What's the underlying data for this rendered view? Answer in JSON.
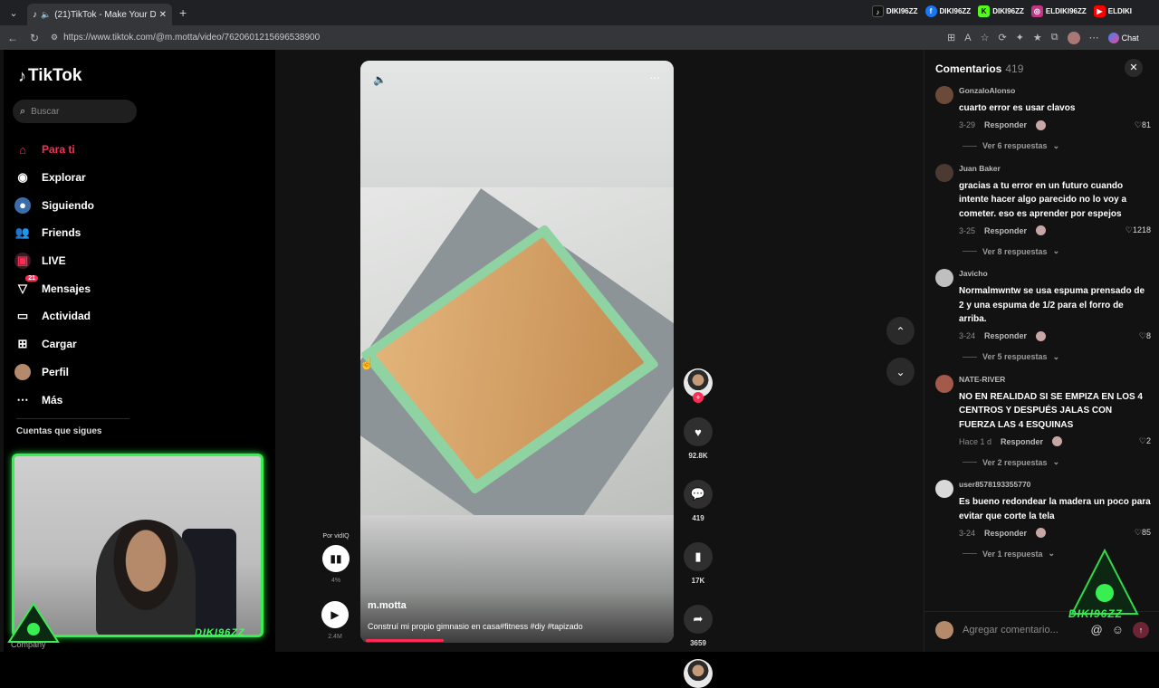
{
  "browser": {
    "tab_count": "(21)",
    "tab_title": "TikTok - Make Your Day",
    "url": "https://www.tiktok.com/@m.motta/video/7620601215696538900",
    "extensions": [
      "DIKI96ZZ",
      "DIKI96ZZ",
      "DIKI96ZZ",
      "ELDIKI96ZZ",
      "ELDIKI"
    ],
    "chat_label": "Chat"
  },
  "sidebar": {
    "logo": "TikTok",
    "search_placeholder": "Buscar",
    "items": [
      {
        "label": "Para ti",
        "icon": "home-icon"
      },
      {
        "label": "Explorar",
        "icon": "compass-icon"
      },
      {
        "label": "Siguiendo",
        "icon": "following-icon"
      },
      {
        "label": "Friends",
        "icon": "friends-icon"
      },
      {
        "label": "LIVE",
        "icon": "live-icon"
      },
      {
        "label": "Mensajes",
        "icon": "message-icon",
        "badge": "21"
      },
      {
        "label": "Actividad",
        "icon": "activity-icon"
      },
      {
        "label": "Cargar",
        "icon": "upload-icon"
      },
      {
        "label": "Perfil",
        "icon": "profile-icon"
      },
      {
        "label": "Más",
        "icon": "more-icon"
      }
    ],
    "following_header": "Cuentas que sigues",
    "company": "Company"
  },
  "webcam": {
    "name": "DIKI96ZZ"
  },
  "video": {
    "author": "m.motta",
    "description": "Construí mi propio gimnasio en casa#fitness #diy #tapizado",
    "progress": 0.25
  },
  "vidiq": {
    "label": "Por vidIQ",
    "percent": "4%",
    "views": "2.4M"
  },
  "actions": {
    "likes": "92.8K",
    "comments": "419",
    "saves": "17K",
    "shares": "3659"
  },
  "comments_panel": {
    "title": "Comentarios",
    "count": "419",
    "reply_label": "Responder",
    "input_placeholder": "Agregar comentario...",
    "items": [
      {
        "user": "GonzaloAlonso",
        "text": "cuarto error es usar clavos",
        "date": "3-29",
        "likes": "81",
        "more": "Ver 6 respuestas"
      },
      {
        "user": "Juan Baker",
        "text": "gracias a tu error en un futuro cuando intente hacer algo parecido no lo voy a cometer. eso es aprender por espejos",
        "date": "3-25",
        "likes": "1218",
        "more": "Ver 8 respuestas"
      },
      {
        "user": "Javicho",
        "text": "Normalmwntw se usa espuma prensado de 2 y una espuma de 1/2 para el forro de arriba.",
        "date": "3-24",
        "likes": "8",
        "more": "Ver 5 respuestas"
      },
      {
        "user": "NATE-RIVER",
        "text": "NO EN REALIDAD SI SE EMPIZA EN LOS 4 CENTROS Y DESPUÉS JALAS CON FUERZA LAS 4 ESQUINAS",
        "date": "Hace 1 d",
        "likes": "2",
        "more": "Ver 2 respuestas"
      },
      {
        "user": "user8578193355770",
        "text": "Es bueno redondear la madera un poco para evitar que corte la tela",
        "date": "3-24",
        "likes": "85",
        "more": "Ver 1 respuesta"
      }
    ]
  },
  "watermark": "DIKI96ZZ",
  "colors": {
    "accent": "#fe2c55",
    "neon": "#38ef52",
    "bg": "#121212"
  }
}
